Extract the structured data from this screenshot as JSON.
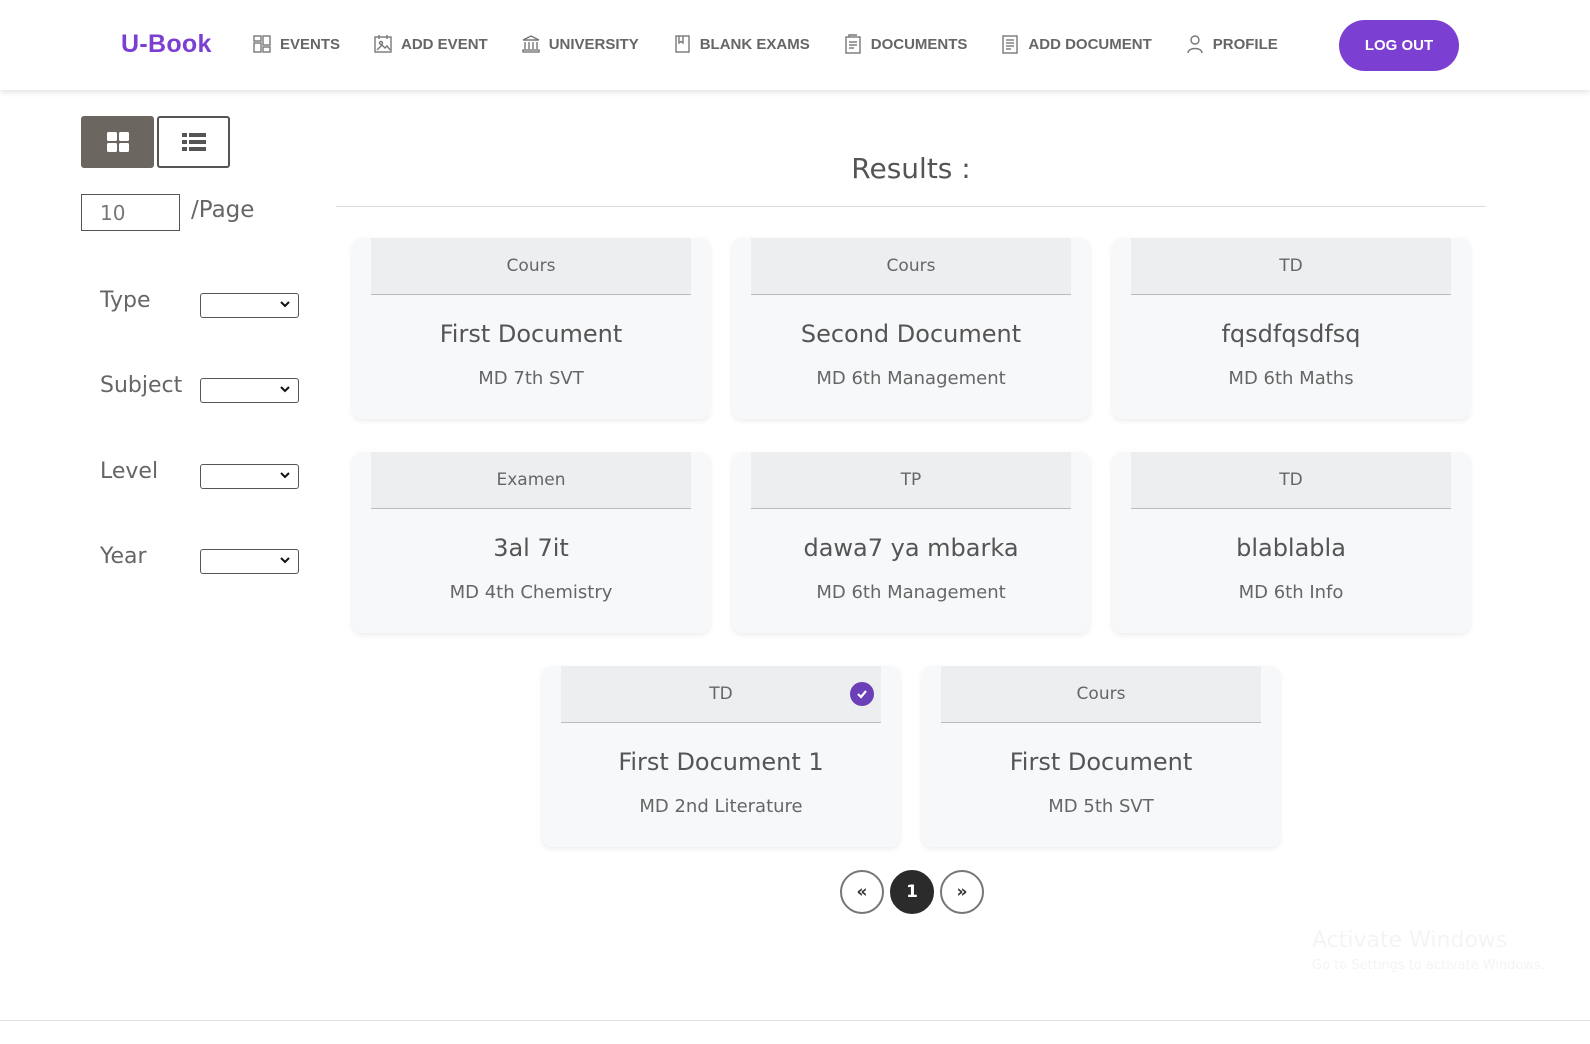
{
  "header": {
    "logo": "U-Book",
    "nav": [
      {
        "label": "EVENTS",
        "icon": "events-icon"
      },
      {
        "label": "ADD EVENT",
        "icon": "add-event-icon"
      },
      {
        "label": "UNIVERSITY",
        "icon": "university-icon"
      },
      {
        "label": "BLANK EXAMS",
        "icon": "book-icon"
      },
      {
        "label": "DOCUMENTS",
        "icon": "documents-icon"
      },
      {
        "label": "ADD DOCUMENT",
        "icon": "add-document-icon"
      },
      {
        "label": "PROFILE",
        "icon": "profile-icon"
      }
    ],
    "logout_label": "LOG OUT",
    "accent_color": "#7b3fd1"
  },
  "sidebar": {
    "per_page_value": "10",
    "per_page_label": "/Page",
    "filters": [
      {
        "label": "Type",
        "value": ""
      },
      {
        "label": "Subject",
        "value": ""
      },
      {
        "label": "Level",
        "value": ""
      },
      {
        "label": "Year",
        "value": ""
      }
    ]
  },
  "results": {
    "title": "Results :",
    "cards": [
      {
        "type": "Cours",
        "title": "First Document",
        "subtitle": "MD 7th SVT",
        "verified": false
      },
      {
        "type": "Cours",
        "title": "Second Document",
        "subtitle": "MD 6th Management",
        "verified": false
      },
      {
        "type": "TD",
        "title": "fqsdfqsdfsq",
        "subtitle": "MD 6th Maths",
        "verified": false
      },
      {
        "type": "Examen",
        "title": "3al 7it",
        "subtitle": "MD 4th Chemistry",
        "verified": false
      },
      {
        "type": "TP",
        "title": "dawa7 ya mbarka",
        "subtitle": "MD 6th Management",
        "verified": false
      },
      {
        "type": "TD",
        "title": "blablabla",
        "subtitle": "MD 6th Info",
        "verified": false
      },
      {
        "type": "TD",
        "title": "First Document 1",
        "subtitle": "MD 2nd Literature",
        "verified": true
      },
      {
        "type": "Cours",
        "title": "First Document",
        "subtitle": "MD 5th SVT",
        "verified": false
      }
    ]
  },
  "pagination": {
    "prev": "«",
    "current": "1",
    "next": "»"
  },
  "watermark": {
    "title": "Activate Windows",
    "subtitle": "Go to Settings to activate Windows."
  }
}
